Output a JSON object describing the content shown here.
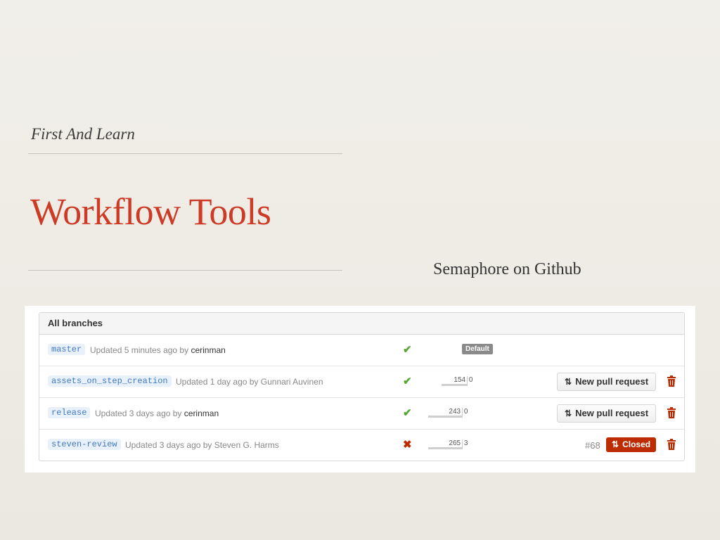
{
  "slide": {
    "kicker": "First And Learn",
    "title": "Workflow Tools",
    "subtitle": "Semaphore on Github"
  },
  "branches": {
    "header": "All branches",
    "rows": [
      {
        "name": "master",
        "updated": "Updated 5 minutes ago by",
        "author": "cerinman",
        "status": "pass",
        "status_icon": "✔",
        "default_badge": "Default"
      },
      {
        "name": "assets_on_step_creation",
        "updated": "Updated 1 day ago by",
        "author": "Gunnari Auvinen",
        "status": "pass",
        "status_icon": "✔",
        "behind": "154",
        "ahead": "0",
        "action": "New pull request"
      },
      {
        "name": "release",
        "updated": "Updated 3 days ago by",
        "author": "cerinman",
        "status": "pass",
        "status_icon": "✔",
        "behind": "243",
        "ahead": "0",
        "action": "New pull request"
      },
      {
        "name": "steven-review",
        "updated": "Updated 3 days ago by",
        "author": "Steven G. Harms",
        "status": "fail",
        "status_icon": "✖",
        "behind": "265",
        "ahead": "3",
        "pr_number": "#68",
        "pr_state": "Closed"
      }
    ]
  },
  "colors": {
    "accent": "#cc3b26",
    "pass": "#55a532",
    "fail": "#bd2c00",
    "link": "#4078c0"
  },
  "icons": {
    "status_pass": "check-icon",
    "status_fail": "x-icon",
    "pull_request": "pull-request-icon",
    "delete": "trash-icon"
  }
}
